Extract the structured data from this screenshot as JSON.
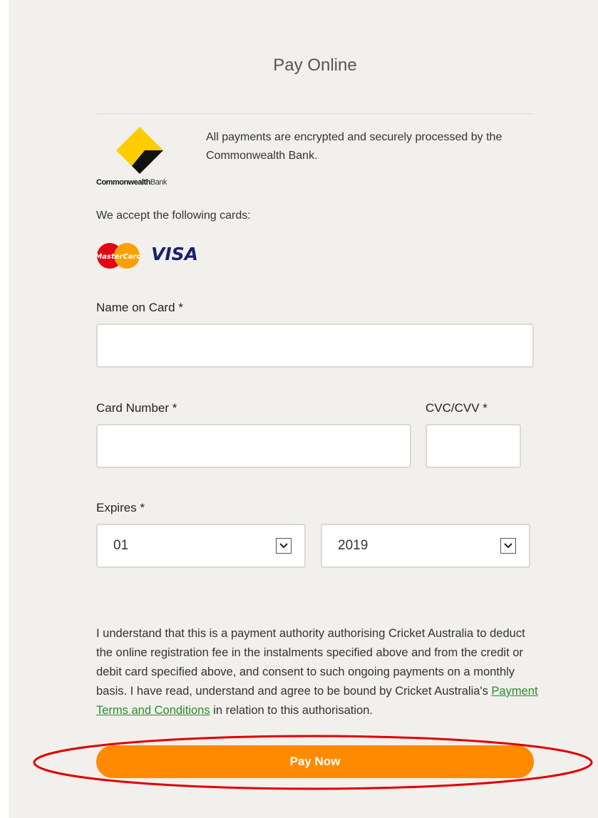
{
  "form": {
    "title": "Pay Online",
    "secure_notice": "All payments are encrypted and securely processed by the Commonwealth Bank.",
    "bank_logo": {
      "wordmark_bold": "Commonwealth",
      "wordmark_light": "Bank",
      "icon": "cba-diamond-icon"
    },
    "accepted_cards_label": "We accept the following cards:",
    "cards": {
      "mastercard_text": "MasterCard",
      "visa_text": "VISA"
    },
    "name_on_card": {
      "label": "Name on Card *",
      "value": ""
    },
    "card_number": {
      "label": "Card Number *",
      "value": ""
    },
    "cvc": {
      "label": "CVC/CVV *",
      "value": ""
    },
    "expires": {
      "label": "Expires *",
      "month": "01",
      "year": "2019"
    },
    "authorisation": {
      "text_before_link": "I understand that this is a payment authority authorising Cricket Australia to deduct the online registration fee in the instalments specified above and from the credit or debit card specified above, and consent to such ongoing payments on a monthly basis. I have read, understand and agree to be bound by Cricket Australia's ",
      "link_text": "Payment Terms and Conditions",
      "text_after_link": " in relation to this authorisation."
    },
    "pay_button_label": "Pay Now"
  },
  "colors": {
    "panel_bg": "#f1f0ec",
    "accent_orange": "#ff8a00",
    "link_green": "#2e8b2e",
    "cba_yellow": "#ffcc00",
    "highlight_red": "#e00000"
  }
}
